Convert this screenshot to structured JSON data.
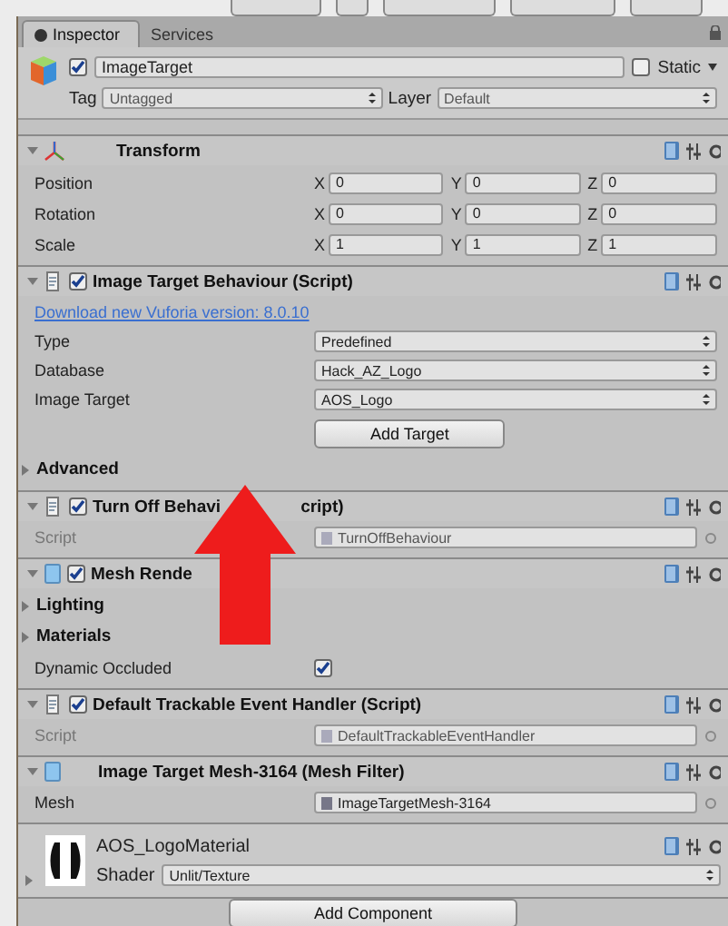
{
  "tabs": [
    {
      "label": "Inspector",
      "selected": true
    },
    {
      "label": "Services",
      "selected": false
    }
  ],
  "object": {
    "name": "ImageTarget",
    "active": true,
    "static_label": "Static",
    "static": false,
    "tag_label": "Tag",
    "tag": "Untagged",
    "layer_label": "Layer",
    "layer": "Default"
  },
  "components": [
    {
      "kind": "transform",
      "title": "Transform",
      "expanded": true,
      "rows": [
        {
          "label": "Position",
          "axes": [
            {
              "axis": "X",
              "value": "0"
            },
            {
              "axis": "Y",
              "value": "0"
            },
            {
              "axis": "Z",
              "value": "0"
            }
          ]
        },
        {
          "label": "Rotation",
          "axes": [
            {
              "axis": "X",
              "value": "0"
            },
            {
              "axis": "Y",
              "value": "0"
            },
            {
              "axis": "Z",
              "value": "0"
            }
          ]
        },
        {
          "label": "Scale",
          "axes": [
            {
              "axis": "X",
              "value": "1"
            },
            {
              "axis": "Y",
              "value": "1"
            },
            {
              "axis": "Z",
              "value": "1"
            }
          ]
        }
      ]
    },
    {
      "kind": "script",
      "title": "Image Target Behaviour (Script)",
      "enabled": true,
      "expanded": true,
      "items": [
        {
          "kind": "link",
          "text": "Download new Vuforia version: 8.0.10"
        },
        {
          "kind": "dropdown",
          "label": "Type",
          "value": "Predefined"
        },
        {
          "kind": "dropdown",
          "label": "Database",
          "value": "Hack_AZ_Logo"
        },
        {
          "kind": "dropdown",
          "label": "Image Target",
          "value": "AOS_Logo"
        },
        {
          "kind": "button",
          "text": "Add Target"
        },
        {
          "kind": "foldout",
          "label": "Advanced",
          "expanded": false
        }
      ]
    },
    {
      "kind": "script",
      "title": "Turn Off Behavi",
      "title_tail": "cript)",
      "enabled": true,
      "expanded": true,
      "items": [
        {
          "kind": "object",
          "label": "Script",
          "value": "TurnOffBehaviour",
          "disabled": true
        }
      ]
    },
    {
      "kind": "mesh",
      "title": "Mesh Rende",
      "enabled": true,
      "expanded": true,
      "items": [
        {
          "kind": "foldout",
          "label": "Lighting",
          "expanded": false
        },
        {
          "kind": "foldout",
          "label": "Materials",
          "expanded": false
        },
        {
          "kind": "checkbox",
          "label": "Dynamic Occluded",
          "checked": true
        }
      ]
    },
    {
      "kind": "script",
      "title": "Default Trackable Event Handler (Script)",
      "enabled": true,
      "expanded": true,
      "items": [
        {
          "kind": "object",
          "label": "Script",
          "value": "DefaultTrackableEventHandler",
          "disabled": true
        }
      ]
    },
    {
      "kind": "mesh",
      "title": "Image Target Mesh-3164 (Mesh Filter)",
      "expanded": true,
      "items": [
        {
          "kind": "object",
          "label": "Mesh",
          "value": "ImageTargetMesh-3164",
          "disabled": false
        }
      ]
    },
    {
      "kind": "material",
      "title": "AOS_LogoMaterial",
      "expanded": false,
      "shader_label": "Shader",
      "shader": "Unlit/Texture"
    }
  ],
  "add_component": "Add Component"
}
